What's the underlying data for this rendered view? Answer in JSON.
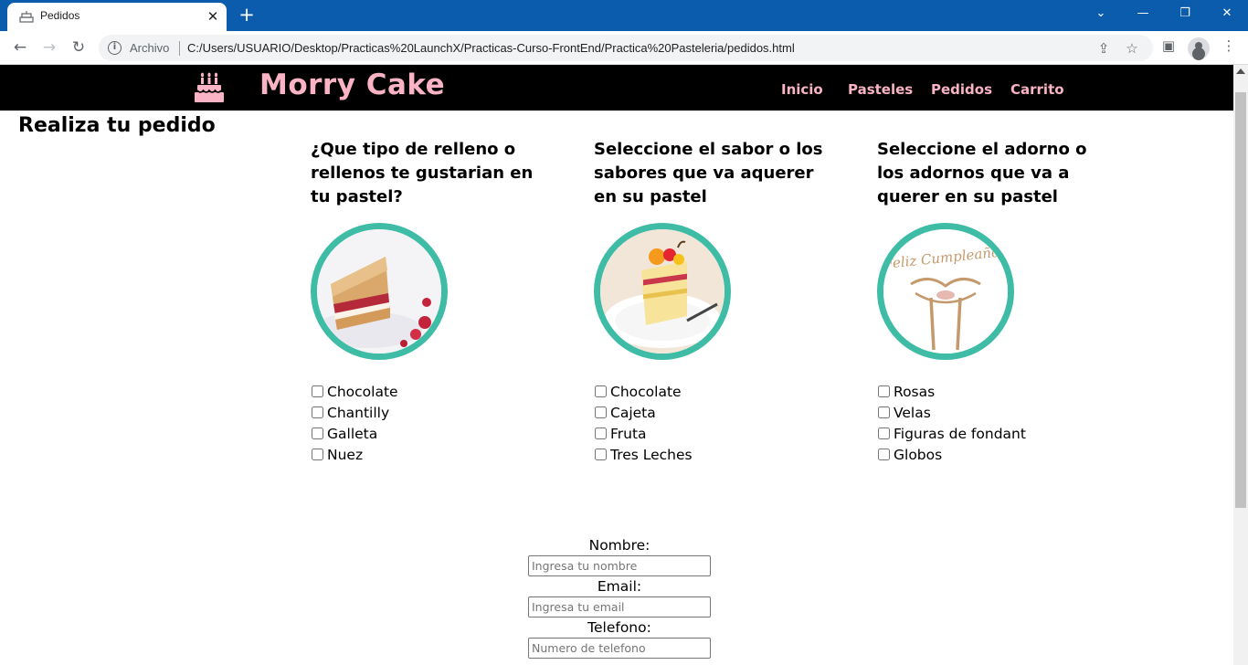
{
  "browser": {
    "tab_title": "Pedidos",
    "tab_close": "✕",
    "new_tab": "+",
    "window_minimize": "—",
    "window_restore": "❐",
    "window_close": "✕",
    "window_menu": "⌄",
    "address_label": "Archivo",
    "url": "C:/Users/USUARIO/Desktop/Practicas%20LaunchX/Practicas-Curso-FrontEnd/Practica%20Pasteleria/pedidos.html",
    "icons": [
      "back-icon",
      "forward-icon",
      "reload-icon",
      "info-icon",
      "share-icon",
      "star-icon",
      "side-panel-icon",
      "profile-icon",
      "menu-icon"
    ]
  },
  "site": {
    "brand": "Morry Cake",
    "logo_icon": "birthday-cake-icon",
    "nav": [
      "Inicio",
      "Pasteles",
      "Pedidos",
      "Carrito"
    ],
    "brand_color": "#f9b3c5",
    "accent_color": "#3fbca6"
  },
  "page_title": "Realiza tu pedido",
  "columns": [
    {
      "title": "¿Que tipo de relleno o rellenos te gustarian en tu pastel?",
      "image": "cake-slice-with-raspberry-filling",
      "options": [
        "Chocolate",
        "Chantilly",
        "Galleta",
        "Nuez"
      ]
    },
    {
      "title": "Seleccione el sabor o los sabores que va aquerer en su pastel",
      "image": "layered-cake-slice-on-plate",
      "options": [
        "Chocolate",
        "Cajeta",
        "Fruta",
        "Tres Leches"
      ]
    },
    {
      "title": "Seleccione el adorno o los adornos que va a querer en su pastel",
      "image": "feliz-cumpleanos-cake-topper",
      "image_text": "Feliz Cumpleaños",
      "options": [
        "Rosas",
        "Velas",
        "Figuras de fondant",
        "Globos"
      ]
    }
  ],
  "form": {
    "name_label": "Nombre:",
    "name_placeholder": "Ingresa tu nombre",
    "email_label": "Email:",
    "email_placeholder": "Ingresa tu email",
    "phone_label": "Telefono:",
    "phone_placeholder": "Numero de telefono"
  }
}
